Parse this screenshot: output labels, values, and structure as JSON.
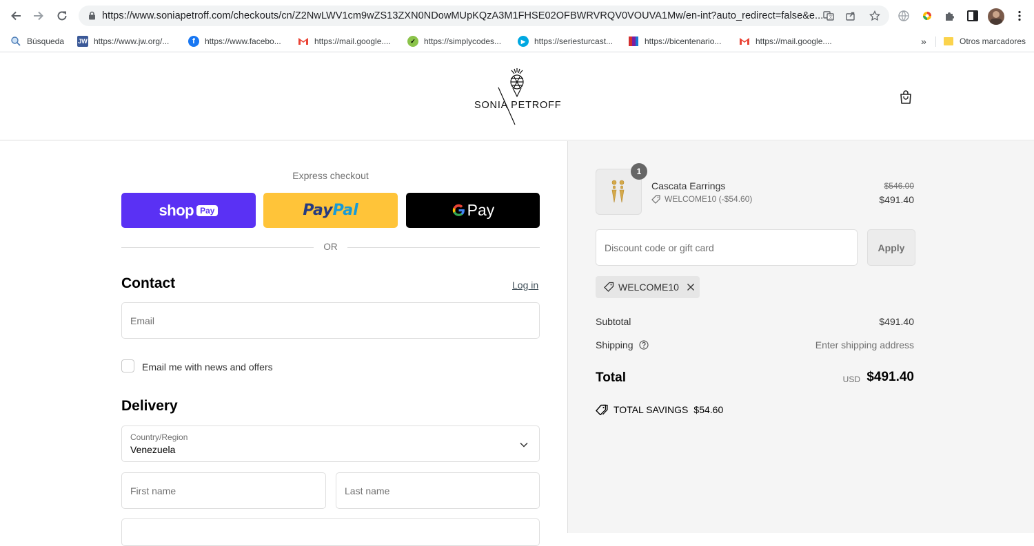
{
  "browser": {
    "url": "https://www.soniapetroff.com/checkouts/cn/Z2NwLWV1cm9wZS13ZXN0NDowMUpKQzA3M1FHSE02OFBWRVRQV0VOUVA1Mw/en-int?auto_redirect=false&e...",
    "bookmarks": [
      {
        "label": "Búsqueda",
        "icon": "search-bookmark-icon"
      },
      {
        "label": "https://www.jw.org/...",
        "icon": "jw-icon"
      },
      {
        "label": "https://www.facebo...",
        "icon": "facebook-icon"
      },
      {
        "label": "https://mail.google....",
        "icon": "gmail-icon"
      },
      {
        "label": "https://simplycodes...",
        "icon": "simplycodes-icon"
      },
      {
        "label": "https://seriesturcast...",
        "icon": "play-icon"
      },
      {
        "label": "https://bicentenario...",
        "icon": "bicentenario-icon"
      },
      {
        "label": "https://mail.google....",
        "icon": "gmail-icon"
      }
    ],
    "overflow": "»",
    "other_bookmarks": "Otros marcadores"
  },
  "header": {
    "brand": "SONIA PETROFF"
  },
  "checkout": {
    "express_title": "Express checkout",
    "shoppay_label": "shop",
    "shoppay_pay": "Pay",
    "paypal_label_a": "Pay",
    "paypal_label_b": "Pal",
    "gpay_label": "Pay",
    "or_label": "OR",
    "contact_title": "Contact",
    "login_label": "Log in",
    "email_placeholder": "Email",
    "newsletter_label": "Email me with news and offers",
    "delivery_title": "Delivery",
    "country_label": "Country/Region",
    "country_value": "Venezuela",
    "first_name_placeholder": "First name",
    "last_name_placeholder": "Last name"
  },
  "summary": {
    "item_count": "1",
    "product_name": "Cascata Earrings",
    "product_discount": "WELCOME10 (-$54.60)",
    "original_price": "$546.00",
    "price": "$491.40",
    "discount_placeholder": "Discount code or gift card",
    "apply_label": "Apply",
    "applied_code": "WELCOME10",
    "subtotal_label": "Subtotal",
    "subtotal_value": "$491.40",
    "shipping_label": "Shipping",
    "shipping_value": "Enter shipping address",
    "total_label": "Total",
    "total_currency": "USD",
    "total_value": "$491.40",
    "savings_label": "TOTAL SAVINGS",
    "savings_value": "$54.60"
  },
  "colors": {
    "shoppay": "#5a31f4",
    "paypal": "#ffc439",
    "gpay": "#000000",
    "summary_bg": "#f5f5f5"
  }
}
